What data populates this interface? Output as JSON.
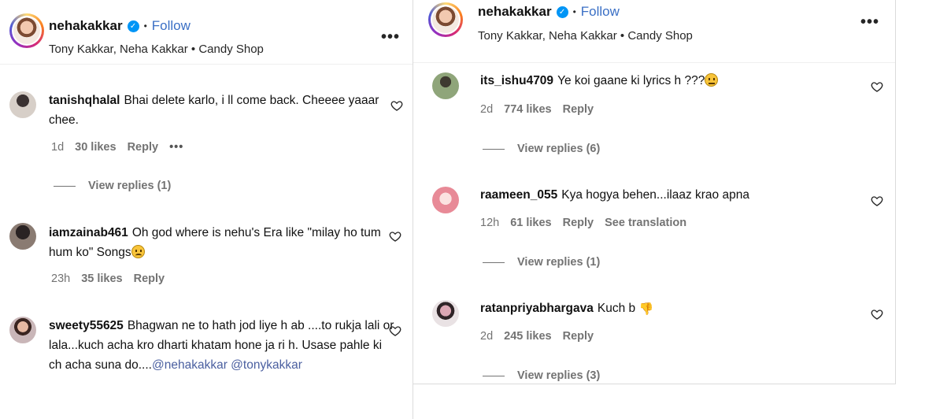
{
  "left": {
    "header": {
      "username": "nehakakkar",
      "verified": "✓",
      "separator": "•",
      "follow": "Follow",
      "subtitle": "Tony Kakkar, Neha Kakkar • Candy Shop",
      "more": "•••"
    },
    "comments": [
      {
        "username": "tanishqhalal",
        "text_line1": "Bhai delete karlo, i ll come back. Cheeee yaaar",
        "text_line2": "chee.",
        "time": "1d",
        "likes": "30 likes",
        "reply": "Reply",
        "more": "•••",
        "view_replies": "View replies (1)"
      },
      {
        "username": "iamzainab461",
        "text_line1": "Oh god where is nehu's Era like \"milay ho tum",
        "text_line2": "hum ko\" Songs",
        "time": "23h",
        "likes": "35 likes",
        "reply": "Reply"
      },
      {
        "username": "sweety55625",
        "text_line1": "Bhagwan ne to hath jod liye h ab ....to rukja lali or",
        "text_line2": "lala...kuch acha kro dharti khatam hone ja ri h. Usase pahle ki",
        "text_line3": "ch acha suna do....",
        "mention1": "@nehakakkar",
        "mention2": "@tonykakkar"
      }
    ]
  },
  "right": {
    "header": {
      "username": "nehakakkar",
      "verified": "✓",
      "separator": "•",
      "follow": "Follow",
      "subtitle": "Tony Kakkar, Neha Kakkar • Candy Shop",
      "more": "•••"
    },
    "comments": [
      {
        "username": "its_ishu4709",
        "text": "Ye koi gaane ki lyrics h ???",
        "time": "2d",
        "likes": "774 likes",
        "reply": "Reply",
        "view_replies": "View replies (6)"
      },
      {
        "username": "raameen_055",
        "text": "Kya hogya behen...ilaaz krao apna",
        "time": "12h",
        "likes": "61 likes",
        "reply": "Reply",
        "translation": "See translation",
        "view_replies": "View replies (1)"
      },
      {
        "username": "ratanpriyabhargava",
        "text": "Kuch b",
        "emoji": "👎",
        "time": "2d",
        "likes": "245 likes",
        "reply": "Reply",
        "view_replies": "View replies (3)"
      }
    ]
  },
  "colors": {
    "follow": "#3a6fc5",
    "verified": "#0095f6",
    "meta": "#737373",
    "mention": "#4a5fa0"
  },
  "icons": [
    "verified-badge-icon",
    "more-options-icon",
    "heart-icon",
    "emoji-icon",
    "thumbs-down-icon"
  ]
}
